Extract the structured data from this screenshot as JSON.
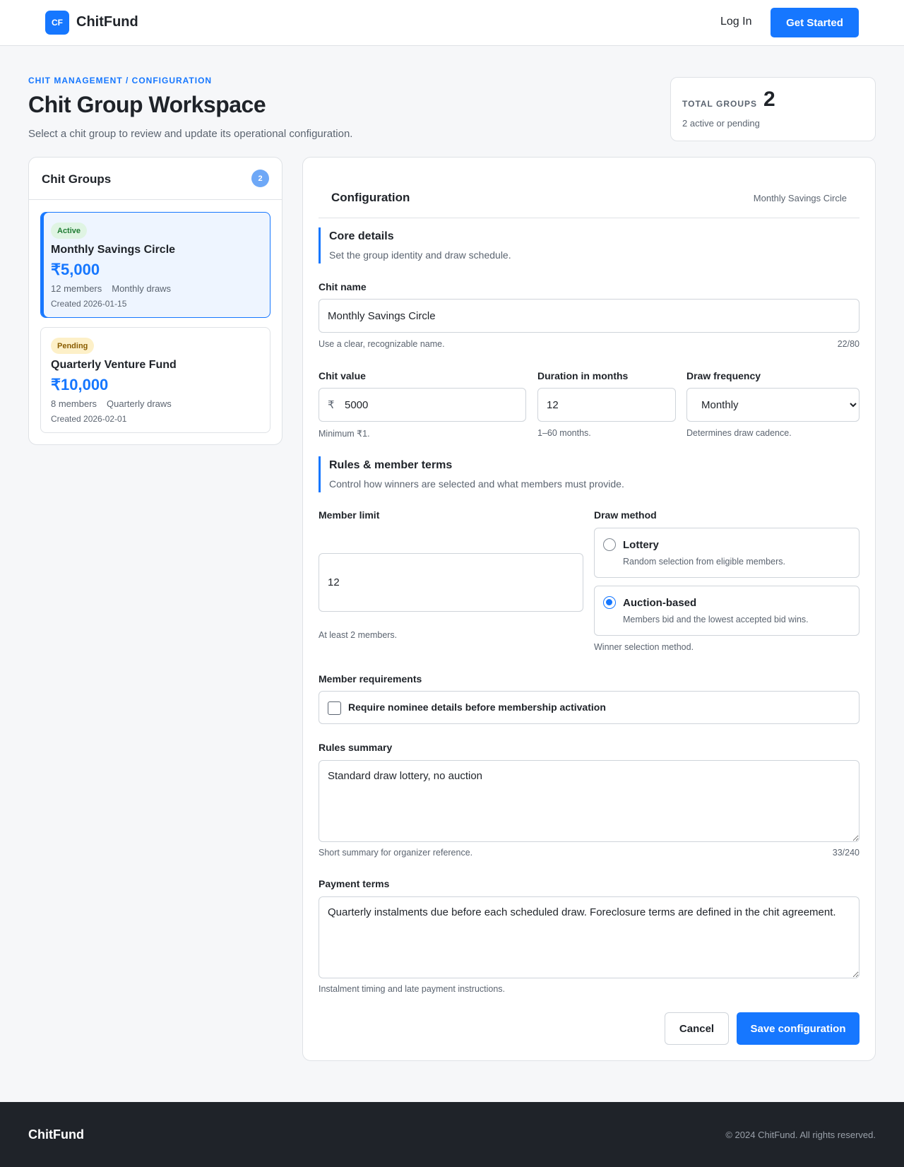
{
  "header": {
    "logo_text": "CF",
    "brand": "ChitFund",
    "login_label": "Log In",
    "cta_label": "Get Started"
  },
  "page": {
    "breadcrumb": "CHIT MANAGEMENT / CONFIGURATION",
    "title": "Chit Group Workspace",
    "subtitle": "Select a chit group to review and update its operational configuration."
  },
  "stats": {
    "label": "TOTAL GROUPS",
    "value": "2",
    "note": "2 active or pending"
  },
  "groups": {
    "title": "Chit Groups",
    "count": "2",
    "items": [
      {
        "status": "Active",
        "name": "Monthly Savings Circle",
        "amount": "₹5,000",
        "members": "12 members",
        "frequency": "Monthly draws",
        "created": "Created 2026-01-15",
        "selected": true
      },
      {
        "status": "Pending",
        "name": "Quarterly Venture Fund",
        "amount": "₹10,000",
        "members": "8 members",
        "frequency": "Quarterly draws",
        "created": "Created 2026-02-01",
        "selected": false
      }
    ]
  },
  "config": {
    "title": "Configuration",
    "selected_group": "Monthly Savings Circle",
    "core": {
      "title": "Core details",
      "description": "Set the group identity and draw schedule."
    },
    "chit_name": {
      "label": "Chit name",
      "value": "Monthly Savings Circle",
      "hint": "Use a clear, recognizable name.",
      "counter": "22/80"
    },
    "chit_value": {
      "label": "Chit value",
      "prefix": "₹",
      "value": "5000",
      "hint": "Minimum ₹1."
    },
    "duration": {
      "label": "Duration in months",
      "value": "12",
      "hint": "1–60 months."
    },
    "draw_frequency": {
      "label": "Draw frequency",
      "value": "Monthly",
      "hint": "Determines draw cadence."
    },
    "rules": {
      "title": "Rules & member terms",
      "description": "Control how winners are selected and what members must provide."
    },
    "member_limit": {
      "label": "Member limit",
      "value": "12",
      "hint": "At least 2 members."
    },
    "draw_method": {
      "label": "Draw method",
      "options": [
        {
          "title": "Lottery",
          "description": "Random selection from eligible members.",
          "checked": false
        },
        {
          "title": "Auction-based",
          "description": "Members bid and the lowest accepted bid wins.",
          "checked": true
        }
      ],
      "hint": "Winner selection method."
    },
    "member_requirements": {
      "label": "Member requirements",
      "checkbox_label": "Require nominee details before membership activation",
      "checked": false
    },
    "rules_summary": {
      "label": "Rules summary",
      "value": "Standard draw lottery, no auction",
      "hint": "Short summary for organizer reference.",
      "counter": "33/240"
    },
    "payment_terms": {
      "label": "Payment terms",
      "value": "Quarterly instalments due before each scheduled draw. Foreclosure terms are defined in the chit agreement.",
      "hint": "Instalment timing and late payment instructions."
    },
    "actions": {
      "cancel_label": "Cancel",
      "save_label": "Save configuration"
    }
  },
  "footer": {
    "brand": "ChitFund",
    "copyright": "© 2024 ChitFund. All rights reserved."
  },
  "colors": {
    "accent": "#1677ff",
    "active_badge": "#dff4e3",
    "pending_badge": "#fdf0c8",
    "footer_bg": "#1f2329"
  }
}
